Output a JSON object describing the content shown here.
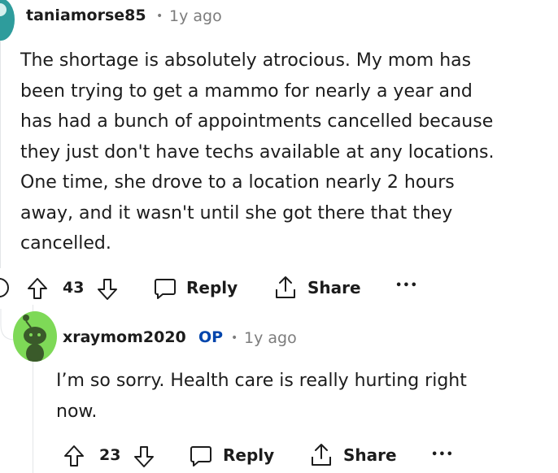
{
  "comment1": {
    "username": "taniamorse85",
    "time": "1y ago",
    "body_lines": [
      "The shortage is absolutely atrocious. My mom has",
      "been trying to get a mammo for nearly a year and",
      "has had a bunch of appointments cancelled because",
      "they just don't have techs available at any locations.",
      "One time, she drove to a location nearly 2 hours",
      "away, and it wasn't until she got there that they",
      "cancelled."
    ],
    "votes": "43",
    "reply_label": "Reply",
    "share_label": "Share",
    "more_label": "•••"
  },
  "comment2": {
    "username": "xraymom2020",
    "op_badge": "OP",
    "time": "1y ago",
    "body_lines": [
      "I’m so sorry. Health care is really hurting right",
      "now."
    ],
    "votes": "23",
    "reply_label": "Reply",
    "share_label": "Share",
    "more_label": "•••"
  },
  "colors": {
    "op": "#0045ac",
    "avatar_reply": "#7ed957",
    "avatar_top": "#2e9c9c"
  },
  "icons": [
    "upvote-icon",
    "downvote-icon",
    "comment-icon",
    "share-icon",
    "collapse-icon"
  ]
}
